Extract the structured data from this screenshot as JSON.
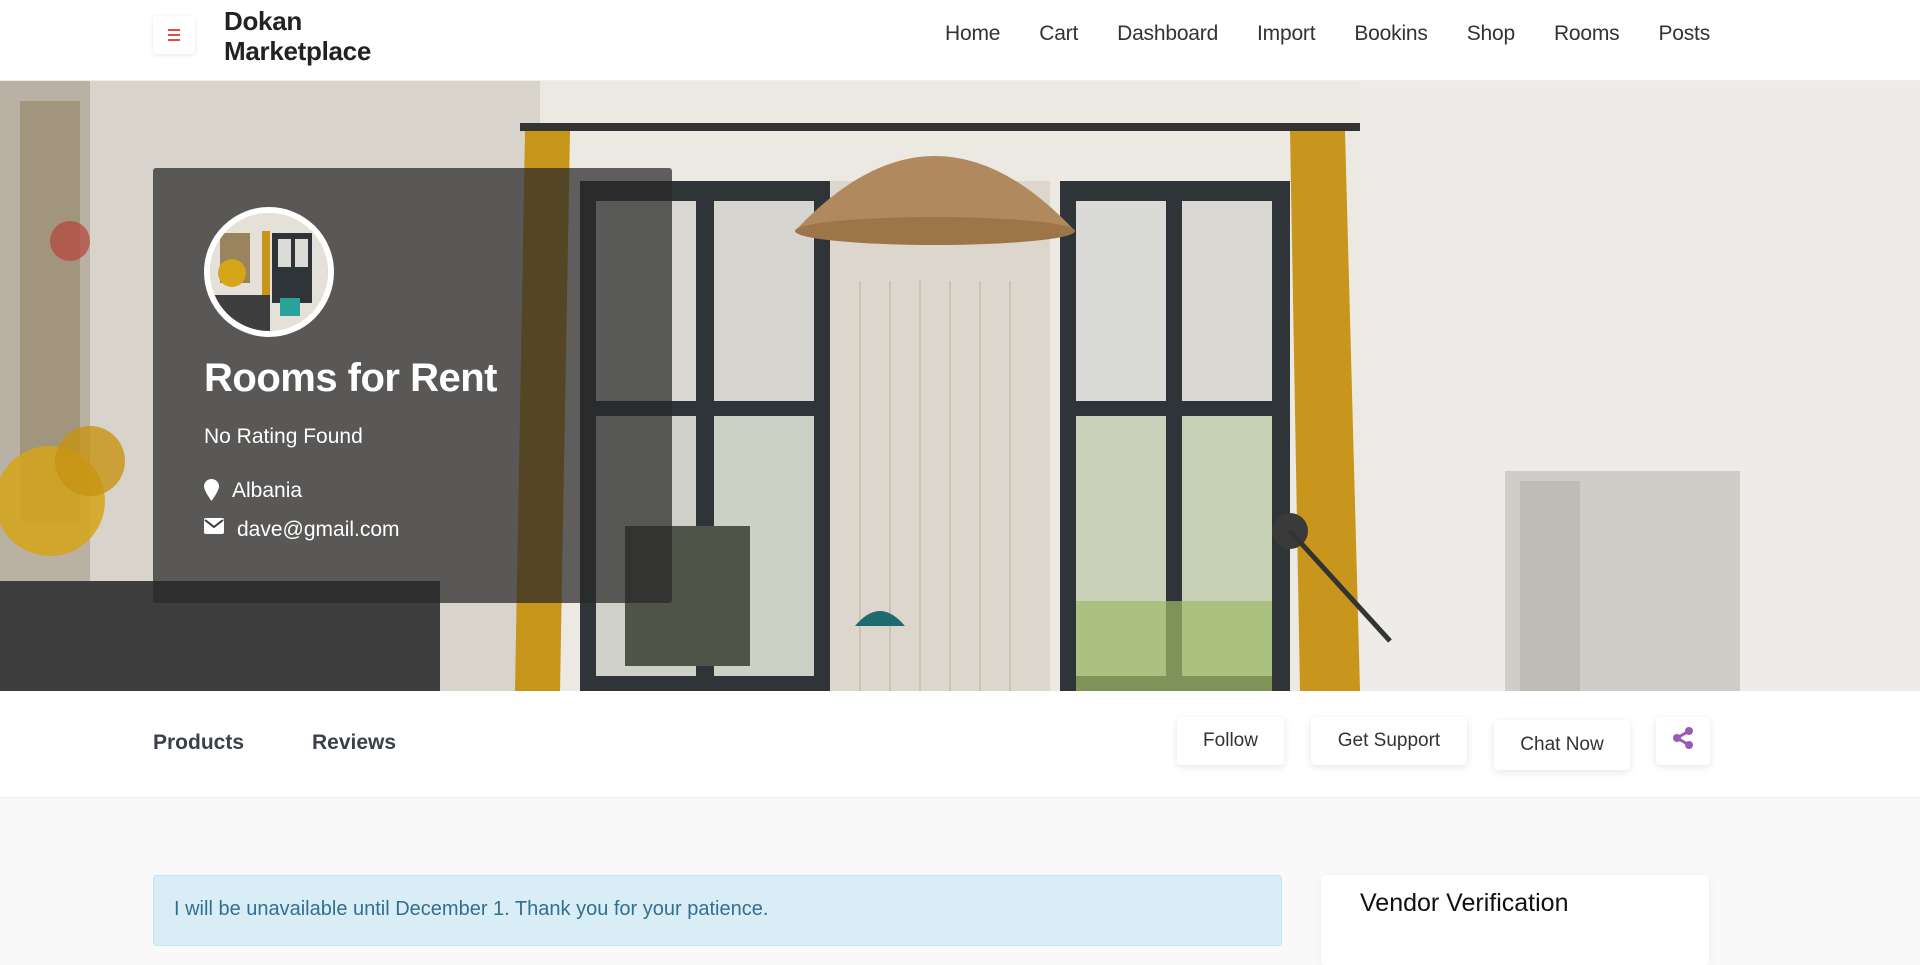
{
  "header": {
    "brand": "Dokan Marketplace",
    "brand_line1": "Dokan",
    "brand_line2": "Marketplace",
    "menu_icon": "hamburger-icon",
    "accent_color": "#e14d43",
    "nav": [
      {
        "label": "Home"
      },
      {
        "label": "Cart"
      },
      {
        "label": "Dashboard"
      },
      {
        "label": "Import"
      },
      {
        "label": "Bookins"
      },
      {
        "label": "Shop"
      },
      {
        "label": "Rooms"
      },
      {
        "label": "Posts"
      }
    ]
  },
  "store": {
    "name": "Rooms for Rent",
    "rating": "No Rating Found",
    "location_icon": "map-marker-icon",
    "location": "Albania",
    "email_icon": "envelope-icon",
    "email": "dave@gmail.com"
  },
  "tabs": [
    {
      "label": "Products"
    },
    {
      "label": "Reviews"
    }
  ],
  "actions": {
    "follow": "Follow",
    "support": "Get Support",
    "chat": "Chat Now",
    "share_icon": "share-icon",
    "share_color": "#9b59b6"
  },
  "notice": {
    "text": "I will be unavailable until December 1. Thank you for your patience."
  },
  "sidebar": {
    "verification_title": "Vendor Verification"
  }
}
